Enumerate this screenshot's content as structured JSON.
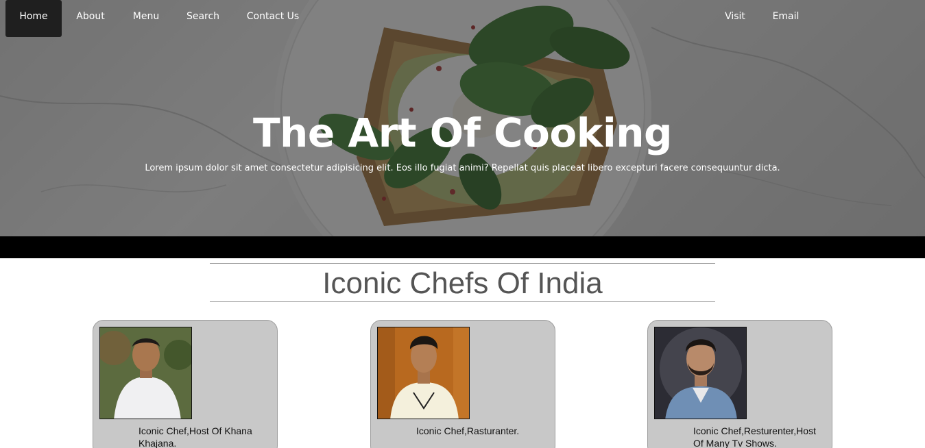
{
  "nav": {
    "left_items": [
      "Home",
      "About",
      "Menu",
      "Search",
      "Contact Us"
    ],
    "right_items": [
      "Visit",
      "Email"
    ],
    "active": "Home"
  },
  "hero": {
    "title": "The Art Of Cooking",
    "subtitle": "Lorem ipsum dolor sit amet consectetur adipisicing elit. Eos illo fugiat animi? Repellat quis placeat libero excepturi facere consequuntur dicta."
  },
  "section": {
    "title": "Iconic Chefs Of India"
  },
  "chefs": [
    {
      "caption": "Iconic Chef,Host Of Khana Khajana.",
      "photo_icon": "chef-portrait-1"
    },
    {
      "caption": "Iconic Chef,Rasturanter.",
      "photo_icon": "chef-portrait-2"
    },
    {
      "caption": "Iconic Chef,Resturenter,Host Of Many Tv Shows.",
      "photo_icon": "chef-portrait-3"
    }
  ],
  "colors": {
    "nav_active_bg": "#1f1f1f",
    "card_bg": "#c8c8c8",
    "band": "#000000"
  }
}
